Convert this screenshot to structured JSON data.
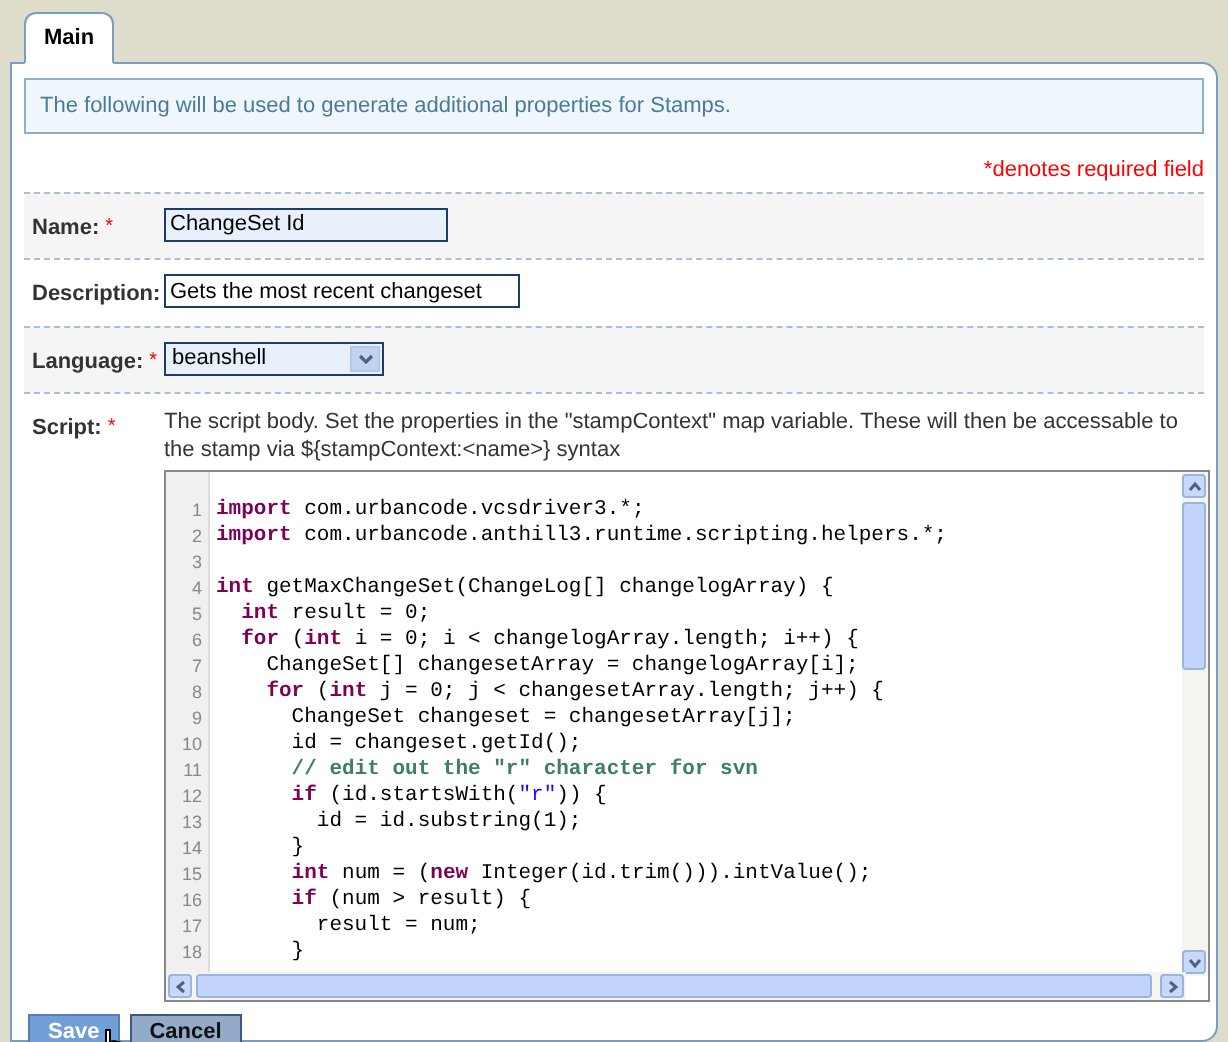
{
  "tabs": [
    {
      "label": "Main",
      "selected": true
    }
  ],
  "info": "The following will be used to generate additional properties for Stamps.",
  "required_note": "*denotes required field",
  "fields": [
    {
      "kind": "text",
      "label": "Name:",
      "required_mark": "*",
      "value": "ChangeSet Id"
    },
    {
      "kind": "text",
      "label": "Description:",
      "value": "Gets the most recent changeset"
    },
    {
      "kind": "select",
      "label": "Language:",
      "required_mark": "*",
      "value": "beanshell"
    },
    {
      "kind": "code",
      "label": "Script:",
      "required_mark": "*",
      "help": "The script body. Set the properties in the \"stampContext\" map variable. These will then be accessable to the stamp via ${stampContext:<name>} syntax",
      "lines": [
        {
          "number": "1",
          "tokens": [
            {
              "kind": "keyword",
              "text": "import"
            },
            {
              "kind": "plain",
              "text": " com.urbancode.vcsdriver3.*;"
            }
          ]
        },
        {
          "number": "2",
          "tokens": [
            {
              "kind": "keyword",
              "text": "import"
            },
            {
              "kind": "plain",
              "text": " com.urbancode.anthill3.runtime.scripting.helpers.*;"
            }
          ]
        },
        {
          "number": "3"
        },
        {
          "number": "4",
          "tokens": [
            {
              "kind": "keyword",
              "text": "int"
            },
            {
              "kind": "plain",
              "text": " getMaxChangeSet(ChangeLog[] changelogArray) {"
            }
          ]
        },
        {
          "number": "5",
          "tokens": [
            {
              "kind": "keyword",
              "text": "  int"
            },
            {
              "kind": "plain",
              "text": " result = 0;"
            }
          ]
        },
        {
          "number": "6",
          "tokens": [
            {
              "kind": "keyword",
              "text": "  for"
            },
            {
              "kind": "plain",
              "text": " ("
            },
            {
              "kind": "keyword",
              "text": "int"
            },
            {
              "kind": "plain",
              "text": " i = 0; i < changelogArray.length; i++) {"
            }
          ]
        },
        {
          "number": "7",
          "tokens": [
            {
              "kind": "plain",
              "text": "    ChangeSet[] changesetArray = changelogArray[i];"
            }
          ]
        },
        {
          "number": "8",
          "tokens": [
            {
              "kind": "keyword",
              "text": "    for"
            },
            {
              "kind": "plain",
              "text": " ("
            },
            {
              "kind": "keyword",
              "text": "int"
            },
            {
              "kind": "plain",
              "text": " j = 0; j < changesetArray.length; j++) {"
            }
          ]
        },
        {
          "number": "9",
          "tokens": [
            {
              "kind": "plain",
              "text": "      ChangeSet changeset = changesetArray[j];"
            }
          ]
        },
        {
          "number": "10",
          "tokens": [
            {
              "kind": "plain",
              "text": "      id = changeset.getId();"
            }
          ]
        },
        {
          "number": "11",
          "tokens": [
            {
              "kind": "comment",
              "text": "      // edit out the \"r\" character for svn"
            }
          ]
        },
        {
          "number": "12",
          "tokens": [
            {
              "kind": "keyword",
              "text": "      if"
            },
            {
              "kind": "plain",
              "text": " (id.startsWith("
            },
            {
              "kind": "string",
              "text": "\"r\""
            },
            {
              "kind": "plain",
              "text": ")) {"
            }
          ]
        },
        {
          "number": "13",
          "tokens": [
            {
              "kind": "plain",
              "text": "        id = id.substring(1);"
            }
          ]
        },
        {
          "number": "14",
          "tokens": [
            {
              "kind": "plain",
              "text": "      }"
            }
          ]
        },
        {
          "number": "15",
          "tokens": [
            {
              "kind": "keyword",
              "text": "      int"
            },
            {
              "kind": "plain",
              "text": " num = ("
            },
            {
              "kind": "keyword",
              "text": "new"
            },
            {
              "kind": "plain",
              "text": " Integer(id.trim())).intValue();"
            }
          ]
        },
        {
          "number": "16",
          "tokens": [
            {
              "kind": "keyword",
              "text": "      if"
            },
            {
              "kind": "plain",
              "text": " (num > result) {"
            }
          ]
        },
        {
          "number": "17",
          "tokens": [
            {
              "kind": "plain",
              "text": "        result = num;"
            }
          ]
        },
        {
          "number": "18",
          "tokens": [
            {
              "kind": "plain",
              "text": "      }"
            }
          ]
        }
      ]
    }
  ],
  "buttons": [
    {
      "kind": "primary",
      "label": "Save"
    },
    {
      "kind": "secondary",
      "label": "Cancel"
    }
  ]
}
